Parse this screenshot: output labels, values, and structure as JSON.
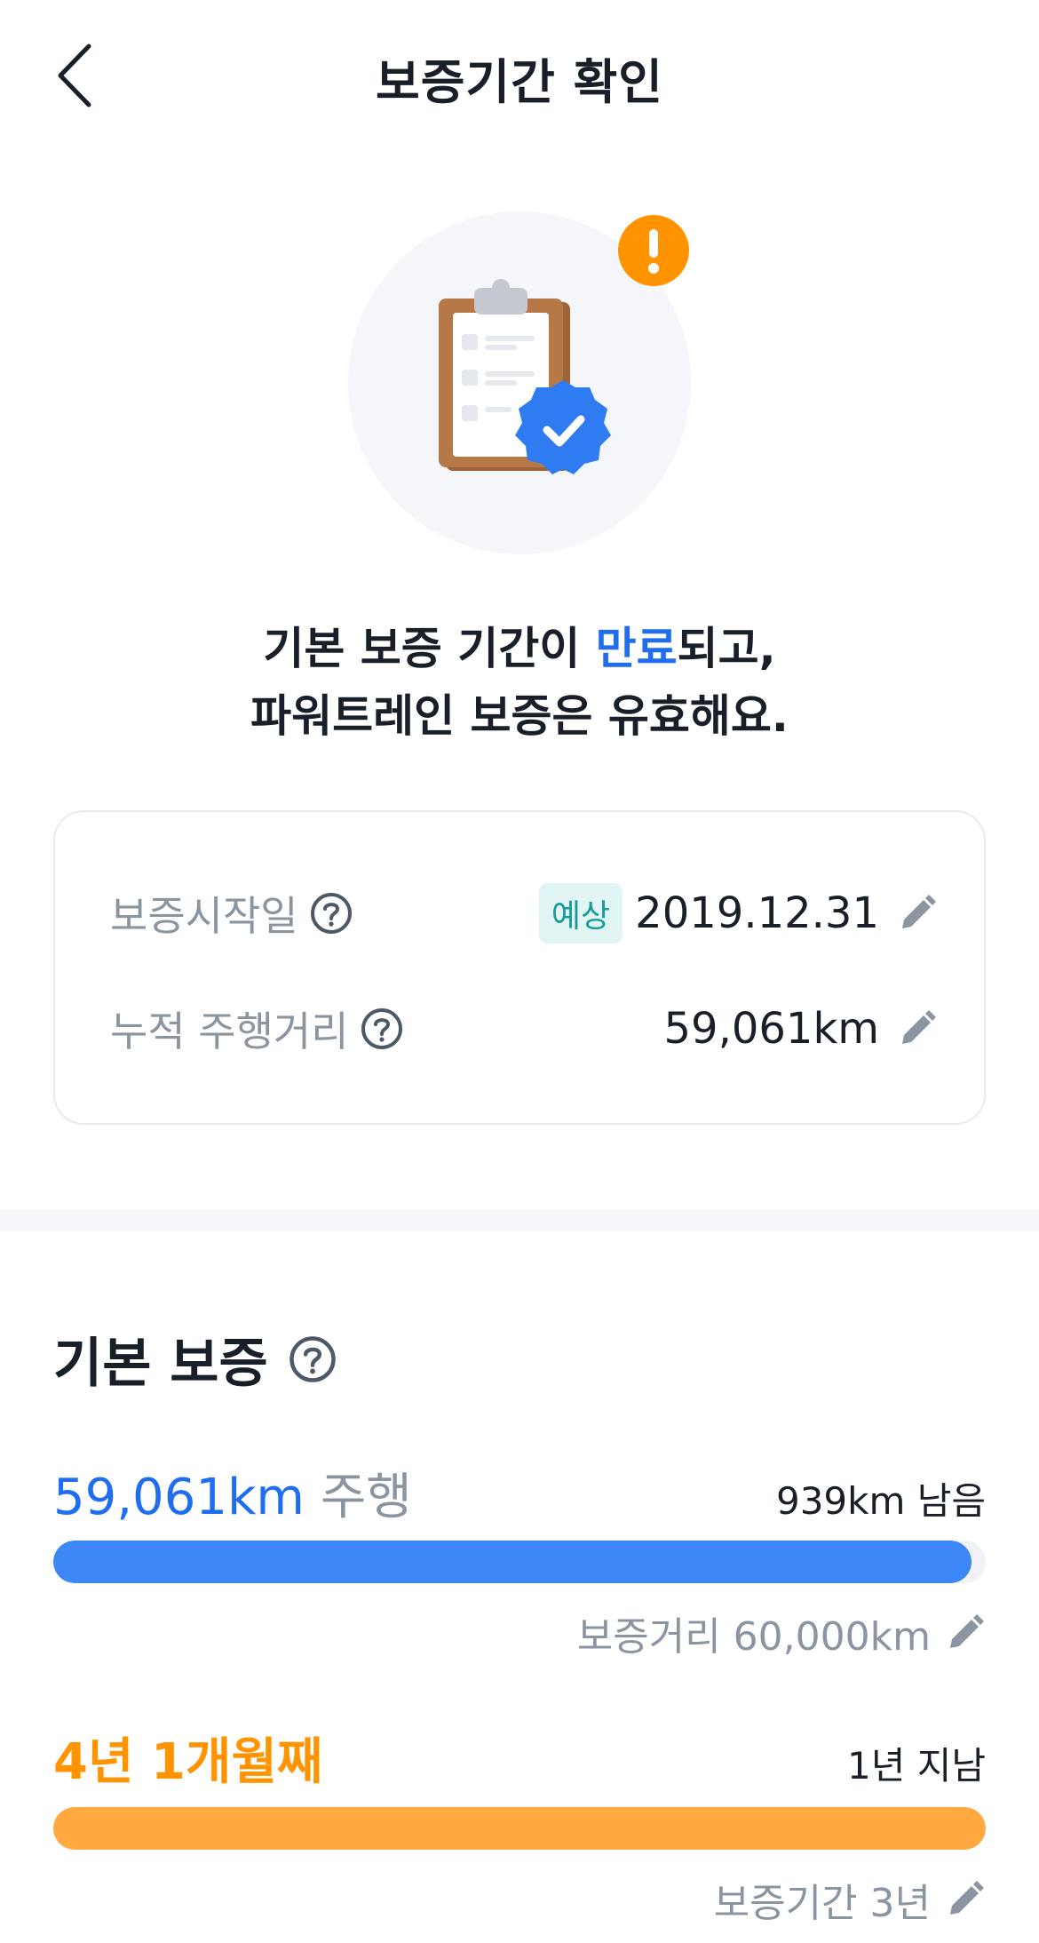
{
  "header": {
    "title": "보증기간 확인"
  },
  "headline": {
    "line1_before": "기본 보증 기간이 ",
    "line1_accent": "만료",
    "line1_after": "되고,",
    "line2": "파워트레인 보증은 유효해요."
  },
  "info": {
    "start_date_label": "보증시작일",
    "start_date_badge": "예상",
    "start_date_value": "2019.12.31",
    "mileage_label": "누적 주행거리",
    "mileage_value": "59,061km"
  },
  "basic_warranty": {
    "title": "기본 보증",
    "distance": {
      "driven": "59,061km",
      "driven_suffix": " 주행",
      "remaining": "939km 남음",
      "progress": 0.9844,
      "limit_label": "보증거리 60,000km"
    },
    "period": {
      "current": "4년 1개월째",
      "status": "1년 지남",
      "progress": 1.0,
      "limit_label": "보증기간 3년"
    }
  },
  "colors": {
    "accent_blue": "#1f6ef0",
    "bar_blue": "#3d86f5",
    "bar_orange": "#ffa940",
    "alert_orange": "#ff9300",
    "muted_gray": "#8b95a1"
  },
  "icons": {
    "back": "chevron-left-icon",
    "help": "question-circle-icon",
    "edit": "pencil-icon",
    "alert": "exclamation-badge-icon",
    "illustration": "clipboard-check-icon"
  }
}
